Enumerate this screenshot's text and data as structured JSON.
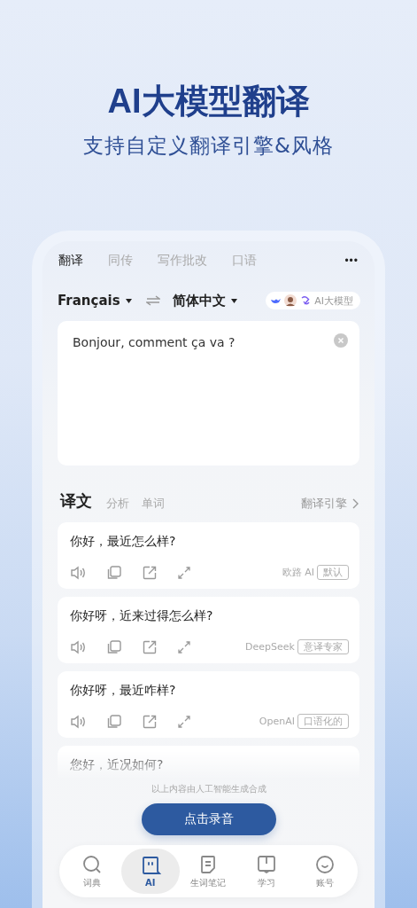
{
  "hero": {
    "title": "AI大模型翻译",
    "subtitle": "支持自定义翻译引擎&风格"
  },
  "tabs": [
    {
      "label": "翻译",
      "selected": true
    },
    {
      "label": "同传",
      "selected": false
    },
    {
      "label": "写作批改",
      "selected": false
    },
    {
      "label": "口语",
      "selected": false
    }
  ],
  "more": "•••",
  "languages": {
    "source": "Français",
    "target": "简体中文",
    "model_badge": "AI大模型"
  },
  "input": {
    "value": "Bonjour, comment ça va ?"
  },
  "result_tabs": [
    {
      "label": "译文",
      "selected": true
    },
    {
      "label": "分析",
      "selected": false
    },
    {
      "label": "单词",
      "selected": false
    }
  ],
  "engine_link": "翻译引擎",
  "results": [
    {
      "text": "你好，最近怎么样?",
      "engine": "欧路 AI",
      "style": "默认"
    },
    {
      "text": "你好呀，近来过得怎么样?",
      "engine": "DeepSeek",
      "style": "意译专家"
    },
    {
      "text": "你好呀，最近咋样?",
      "engine": "OpenAI",
      "style": "口语化的"
    },
    {
      "text": "您好，近况如何?"
    }
  ],
  "disclaimer": "以上内容由人工智能生成合成",
  "record_button": "点击录音",
  "nav": [
    {
      "label": "词典",
      "kind": "search",
      "selected": false
    },
    {
      "label": "AI",
      "kind": "bot",
      "selected": true
    },
    {
      "label": "生词笔记",
      "kind": "note",
      "selected": false
    },
    {
      "label": "学习",
      "kind": "book",
      "selected": false
    },
    {
      "label": "账号",
      "kind": "smile",
      "selected": false
    }
  ]
}
